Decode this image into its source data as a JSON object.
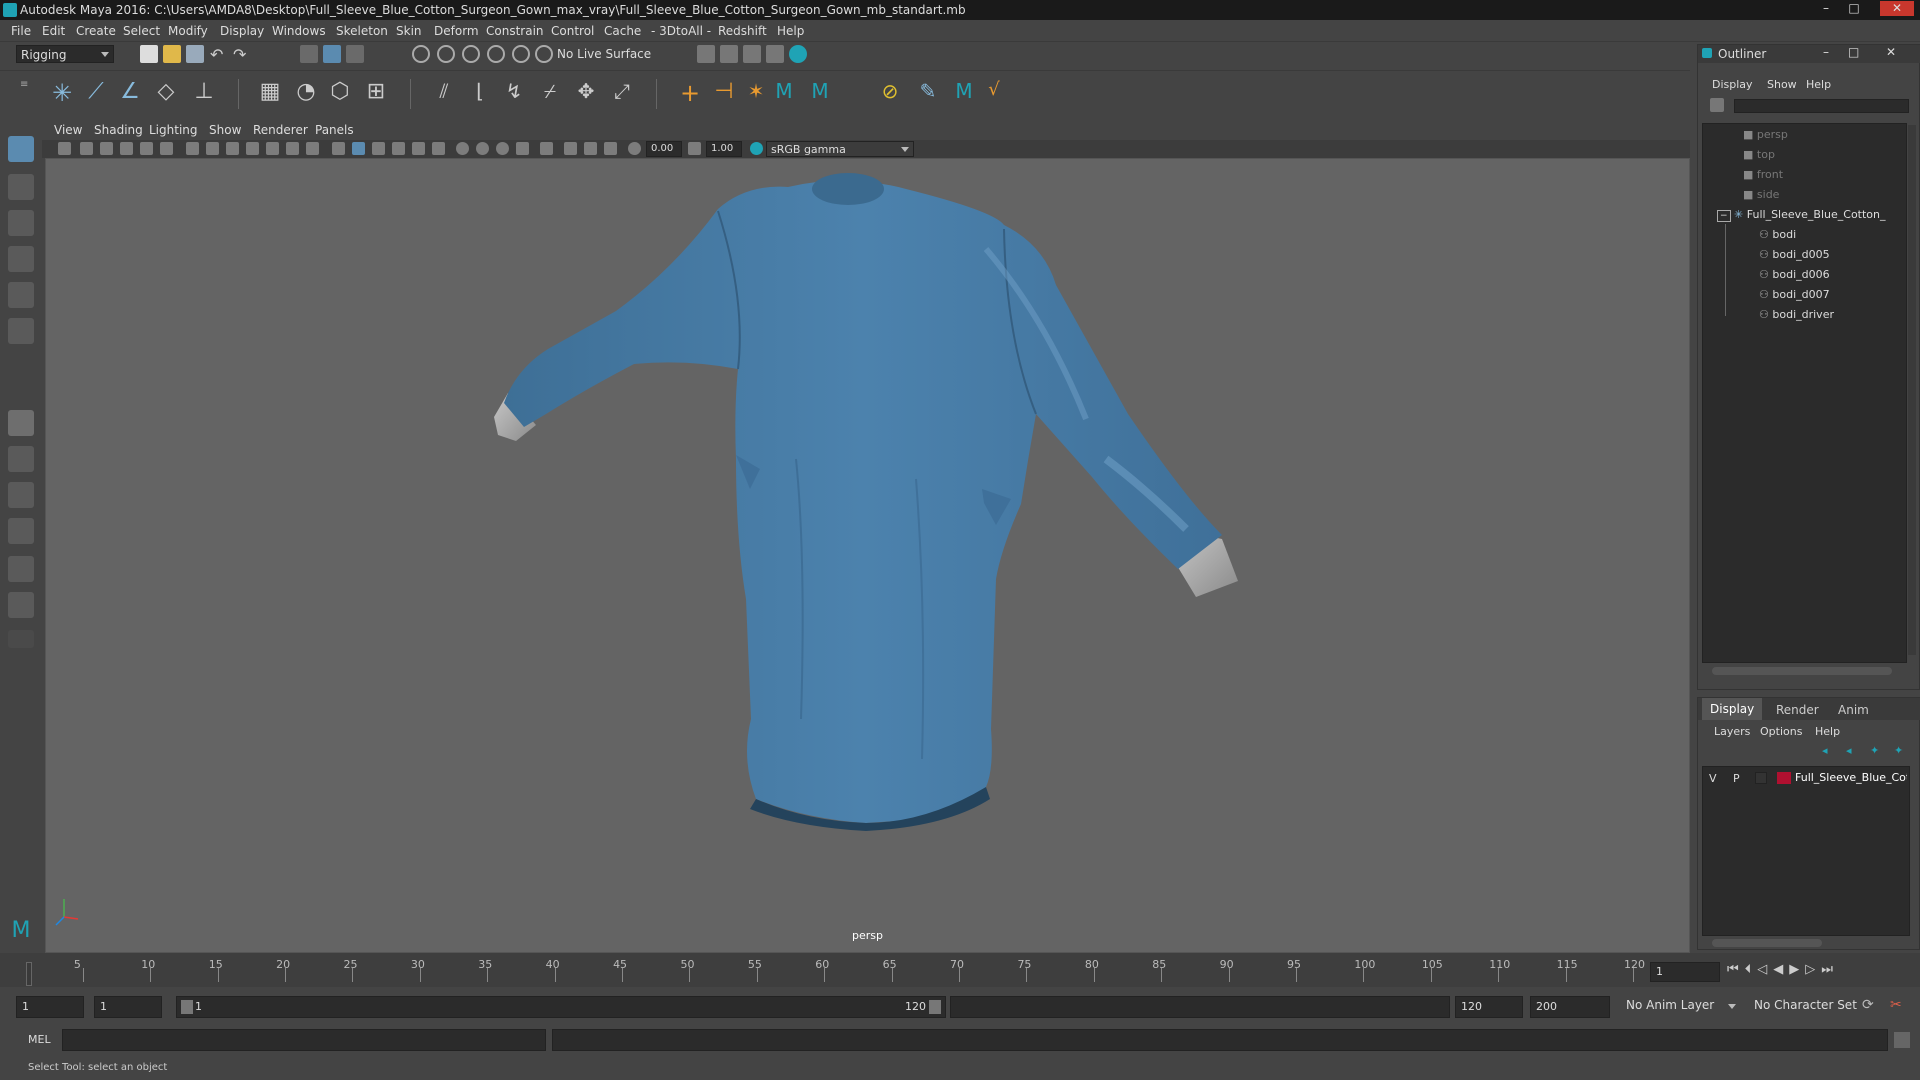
{
  "title": "Autodesk Maya 2016: C:\\Users\\AMDA8\\Desktop\\Full_Sleeve_Blue_Cotton_Surgeon_Gown_max_vray\\Full_Sleeve_Blue_Cotton_Surgeon_Gown_mb_standart.mb",
  "window_controls": [
    "–",
    "□",
    "✕"
  ],
  "menu": [
    "File",
    "Edit",
    "Create",
    "Select",
    "Modify",
    "Display",
    "Windows",
    "Skeleton",
    "Skin",
    "Deform",
    "Constrain",
    "Control",
    "Cache",
    "- 3DtoAll -",
    "Redshift",
    "Help"
  ],
  "status_line": {
    "menuset": "Rigging",
    "live_surface": "No Live Surface"
  },
  "panel_menu": [
    "View",
    "Shading",
    "Lighting",
    "Show",
    "Renderer",
    "Panels"
  ],
  "panel_toolbar": {
    "exposure": "0.00",
    "gamma": "1.00",
    "color_space": "sRGB gamma"
  },
  "viewport": {
    "camera_label": "persp",
    "background": "#646464",
    "object_color": "#4a7fa8"
  },
  "outliner": {
    "title": "Outliner",
    "menu": [
      "Display",
      "Show",
      "Help"
    ],
    "items": [
      {
        "label": "persp",
        "dim": true,
        "indent": 1
      },
      {
        "label": "top",
        "dim": true,
        "indent": 1
      },
      {
        "label": "front",
        "dim": true,
        "indent": 1
      },
      {
        "label": "side",
        "dim": true,
        "indent": 1
      },
      {
        "label": "Full_Sleeve_Blue_Cotton_",
        "dim": false,
        "indent": 0
      },
      {
        "label": "bodi",
        "dim": false,
        "indent": 2
      },
      {
        "label": "bodi_d005",
        "dim": false,
        "indent": 2
      },
      {
        "label": "bodi_d006",
        "dim": false,
        "indent": 2
      },
      {
        "label": "bodi_d007",
        "dim": false,
        "indent": 2
      },
      {
        "label": "bodi_driver",
        "dim": false,
        "indent": 2
      }
    ]
  },
  "layer_editor": {
    "tabs": [
      "Display",
      "Render",
      "Anim"
    ],
    "active_tab": "Display",
    "menu": [
      "Layers",
      "Options",
      "Help"
    ],
    "layer": {
      "v": "V",
      "p": "P",
      "name": "Full_Sleeve_Blue_Cotto",
      "color": "#b01030"
    }
  },
  "timeline": {
    "ticks": [
      "1",
      "5",
      "10",
      "15",
      "20",
      "25",
      "30",
      "35",
      "40",
      "45",
      "50",
      "55",
      "60",
      "65",
      "70",
      "75",
      "80",
      "85",
      "90",
      "95",
      "100",
      "105",
      "110",
      "115",
      "120"
    ],
    "current_frame": "1"
  },
  "range": {
    "start": "1",
    "playback_start": "1",
    "range_start_label": "1",
    "range_end_label": "120",
    "playback_end": "120",
    "end": "200",
    "anim_layer": "No Anim Layer",
    "character_set": "No Character Set"
  },
  "command_line": {
    "label": "MEL"
  },
  "help_line": "Select Tool: select an object"
}
